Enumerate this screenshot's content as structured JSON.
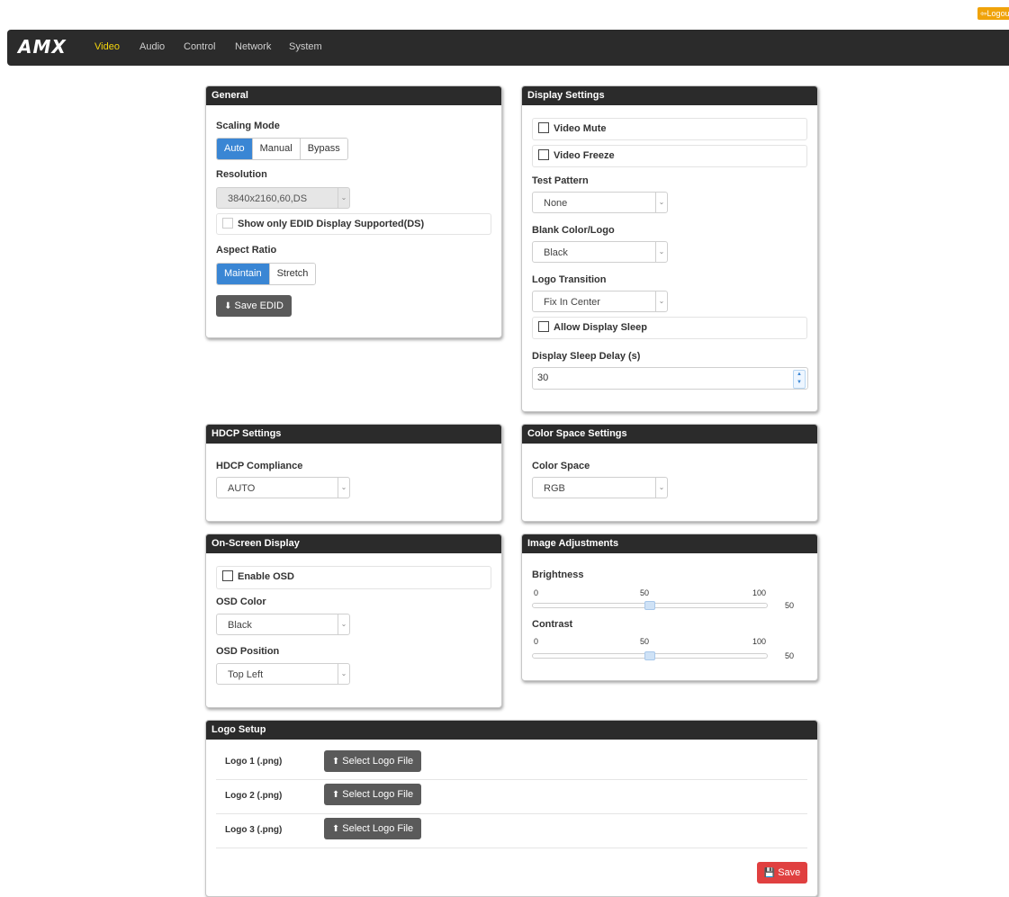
{
  "header": {
    "logout_label": "Logout",
    "logo_text": "AMX"
  },
  "nav": {
    "items": [
      {
        "label": "Video",
        "active": true
      },
      {
        "label": "Audio"
      },
      {
        "label": "Control"
      },
      {
        "label": "Network"
      },
      {
        "label": "System"
      }
    ]
  },
  "general": {
    "title": "General",
    "scaling_mode_label": "Scaling Mode",
    "scaling_modes": [
      "Auto",
      "Manual",
      "Bypass"
    ],
    "scaling_selected": "Auto",
    "resolution_label": "Resolution",
    "resolution_value": "3840x2160,60,DS",
    "edid_only_label": "Show only EDID Display Supported(DS)",
    "aspect_ratio_label": "Aspect Ratio",
    "aspect_options": [
      "Maintain",
      "Stretch"
    ],
    "aspect_selected": "Maintain",
    "save_edid_label": "Save EDID"
  },
  "display": {
    "title": "Display Settings",
    "video_mute_label": "Video Mute",
    "video_freeze_label": "Video Freeze",
    "test_pattern_label": "Test Pattern",
    "test_pattern_value": "None",
    "blank_label": "Blank Color/Logo",
    "blank_value": "Black",
    "logo_transition_label": "Logo Transition",
    "logo_transition_value": "Fix In Center",
    "allow_sleep_label": "Allow Display Sleep",
    "sleep_delay_label": "Display Sleep Delay (s)",
    "sleep_delay_value": "30"
  },
  "hdcp": {
    "title": "HDCP Settings",
    "compliance_label": "HDCP Compliance",
    "compliance_value": "AUTO"
  },
  "color_space": {
    "title": "Color Space Settings",
    "label": "Color Space",
    "value": "RGB"
  },
  "osd": {
    "title": "On-Screen Display",
    "enable_label": "Enable OSD",
    "color_label": "OSD Color",
    "color_value": "Black",
    "position_label": "OSD Position",
    "position_value": "Top Left"
  },
  "image": {
    "title": "Image Adjustments",
    "brightness_label": "Brightness",
    "brightness": {
      "min": "0",
      "mid": "50",
      "max": "100",
      "value": "50"
    },
    "contrast_label": "Contrast",
    "contrast": {
      "min": "0",
      "mid": "50",
      "max": "100",
      "value": "50"
    }
  },
  "logo_setup": {
    "title": "Logo Setup",
    "rows": [
      {
        "label": "Logo 1 (.png)",
        "button": "Select Logo File"
      },
      {
        "label": "Logo 2 (.png)",
        "button": "Select Logo File"
      },
      {
        "label": "Logo 3 (.png)",
        "button": "Select Logo File"
      }
    ],
    "save_label": "Save"
  },
  "colors": {
    "accent": "#3a86d4",
    "nav_active": "#f5d60c",
    "header": "#2b2b2b",
    "save": "#e04040",
    "logout": "#f0a30a"
  }
}
